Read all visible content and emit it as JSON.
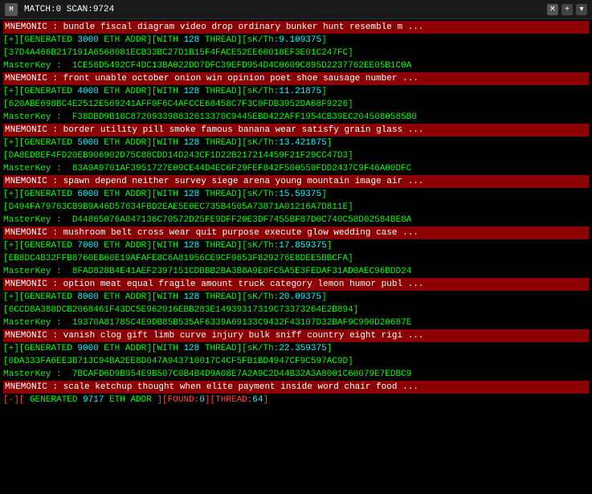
{
  "titlebar": {
    "icon": "M",
    "title": "MATCH:0 SCAN:9724",
    "close_btn": "✕",
    "plus_btn": "+",
    "caret_btn": "▾"
  },
  "lines": [
    {
      "type": "mnemonic",
      "text": "MNEMONIC : bundle fiscal diagram video drop ordinary bunker hunt resemble m ..."
    },
    {
      "type": "generated",
      "prefix": "[+][GENERATED",
      "num": "3000",
      "mid": "ETH ADDR][WITH",
      "threads": "128",
      "thread_label": "THREAD]",
      "sk_label": "[sK/Th:",
      "sk_val": "9.109375",
      "suffix": "]"
    },
    {
      "type": "hash",
      "text": "[37D4A466B217191A6568081ECB33BC27D1B15F4FACE52EE60018EF3E01C247FC]"
    },
    {
      "type": "masterkey",
      "label": "MasterKey :",
      "value": "1CE56D5492CF4DC13BA022DD7DFC39EFD954D4C0609C895D2237762EE05B1C0A"
    },
    {
      "type": "mnemonic",
      "text": "MNEMONIC : front unable october onion win opinion poet shoe sausage number ..."
    },
    {
      "type": "generated",
      "prefix": "[+][GENERATED",
      "num": "4000",
      "mid": "ETH ADDR][WITH",
      "threads": "128",
      "thread_label": "THREAD]",
      "sk_label": "[sK/Th:",
      "sk_val": "11.21875",
      "suffix": "]"
    },
    {
      "type": "hash",
      "text": "[620ABE698BC4E2512E569241AFF0F6C4AFCCE68458C7F3C0FDB3952DA68F9226]"
    },
    {
      "type": "masterkey",
      "label": "MasterKey :",
      "value": "F38DBD9B18C872093398832613370C9445EBD422AFF1954CB39EC2045080585B0"
    },
    {
      "type": "mnemonic",
      "text": "MNEMONIC : border utility pill smoke famous banana wear satisfy grain glass ..."
    },
    {
      "type": "generated",
      "prefix": "[+][GENERATED",
      "num": "5000",
      "mid": "ETH ADDR][WITH",
      "threads": "128",
      "thread_label": "THREAD]",
      "sk_label": "[sK/Th:",
      "sk_val": "13.421875",
      "suffix": "]"
    },
    {
      "type": "hash",
      "text": "[DA8EDBEF4FD20EB906902D75C88CDD14D243CF1D22B217214459F21F29CC47D3]"
    },
    {
      "type": "masterkey",
      "label": "MasterKey :",
      "value": "83A9A9701AF3951727E09CE44D4EC6F29FEF842F500550FDD2437C9F46A00DFC"
    },
    {
      "type": "mnemonic",
      "text": "MNEMONIC : spawn depend neither survey siege arena young mountain image air ..."
    },
    {
      "type": "generated",
      "prefix": "[+][GENERATED",
      "num": "6000",
      "mid": "ETH ADDR][WITH",
      "threads": "128",
      "thread_label": "THREAD]",
      "sk_label": "[sK/Th:",
      "sk_val": "15.59375",
      "suffix": "]"
    },
    {
      "type": "hash",
      "text": "[D494FA79763CB9B9A46D57634FBD2EAE5E0EC735B4505A73871A01216A7D811E]"
    },
    {
      "type": "masterkey",
      "label": "MasterKey :",
      "value": "D44865076A847136C70572D25FE9DFF20E3DF7455BF87D0C740C58D02584BE8A"
    },
    {
      "type": "mnemonic",
      "text": "MNEMONIC : mushroom belt cross wear quit purpose execute glow wedding case ..."
    },
    {
      "type": "generated",
      "prefix": "[+][GENERATED",
      "num": "7000",
      "mid": "ETH ADDR][WITH",
      "threads": "128",
      "thread_label": "THREAD]",
      "sk_label": "[sK/Th:",
      "sk_val": "17.859375",
      "suffix": "]"
    },
    {
      "type": "hash",
      "text": "[EB8DC4B32FFB8760EB60E19AFAFE8C6A81956CE9CF9653F829276E8DEE5BBCFA]"
    },
    {
      "type": "masterkey",
      "label": "MasterKey :",
      "value": "8FAD828B4E41AEF2397151CDBBB2BA3B8A9E8FC5A5E3FEDAF31AD0AEC96BDD24"
    },
    {
      "type": "mnemonic",
      "text": "MNEMONIC : option meat equal fragile amount truck category lemon humor publ ..."
    },
    {
      "type": "generated",
      "prefix": "[+][GENERATED",
      "num": "8000",
      "mid": "ETH ADDR][WITH",
      "threads": "128",
      "thread_label": "THREAD]",
      "sk_label": "[sK/Th:",
      "sk_val": "20.09375",
      "suffix": "]"
    },
    {
      "type": "hash",
      "text": "[6CCD8A388DCB2068461F43DC5E962016EBB283E14939317319C73373264E2B894]"
    },
    {
      "type": "masterkey",
      "label": "MasterKey :",
      "value": "19370A81785C4E9DB85B535AF6339A69133C9432F43107D32BAF9C990D20687E"
    },
    {
      "type": "mnemonic",
      "text": "MNEMONIC : vanish clog gift limb curve injury bulk sniff country eight rigi ..."
    },
    {
      "type": "generated",
      "prefix": "[+][GENERATED",
      "num": "9000",
      "mid": "ETH ADDR][WITH",
      "threads": "128",
      "thread_label": "THREAD]",
      "sk_label": "[sK/Th:",
      "sk_val": "22.359375",
      "suffix": "]"
    },
    {
      "type": "hash",
      "text": "[0DA333FA6EE3B713C94BA2EE8D047A943710017C4CF5FB1BD4947CF9C597AC9D]"
    },
    {
      "type": "masterkey",
      "label": "MasterKey :",
      "value": "7BCAFD6D9B954E9B507C0B4B4D9A08E7A2A9C2D44B32A3A8001C60079E7EDBC9"
    },
    {
      "type": "mnemonic",
      "text": "MNEMONIC : scale ketchup thought when elite payment inside word chair food ..."
    },
    {
      "type": "bottombar",
      "prefix": "[-][",
      "label": "GENERATED",
      "num": "9717",
      "mid": "ETH ADDR",
      "found_label": "][FOUND:",
      "found_val": "0",
      "thread_label": "][THREAD:",
      "thread_val": "64",
      "suffix": "]"
    }
  ]
}
